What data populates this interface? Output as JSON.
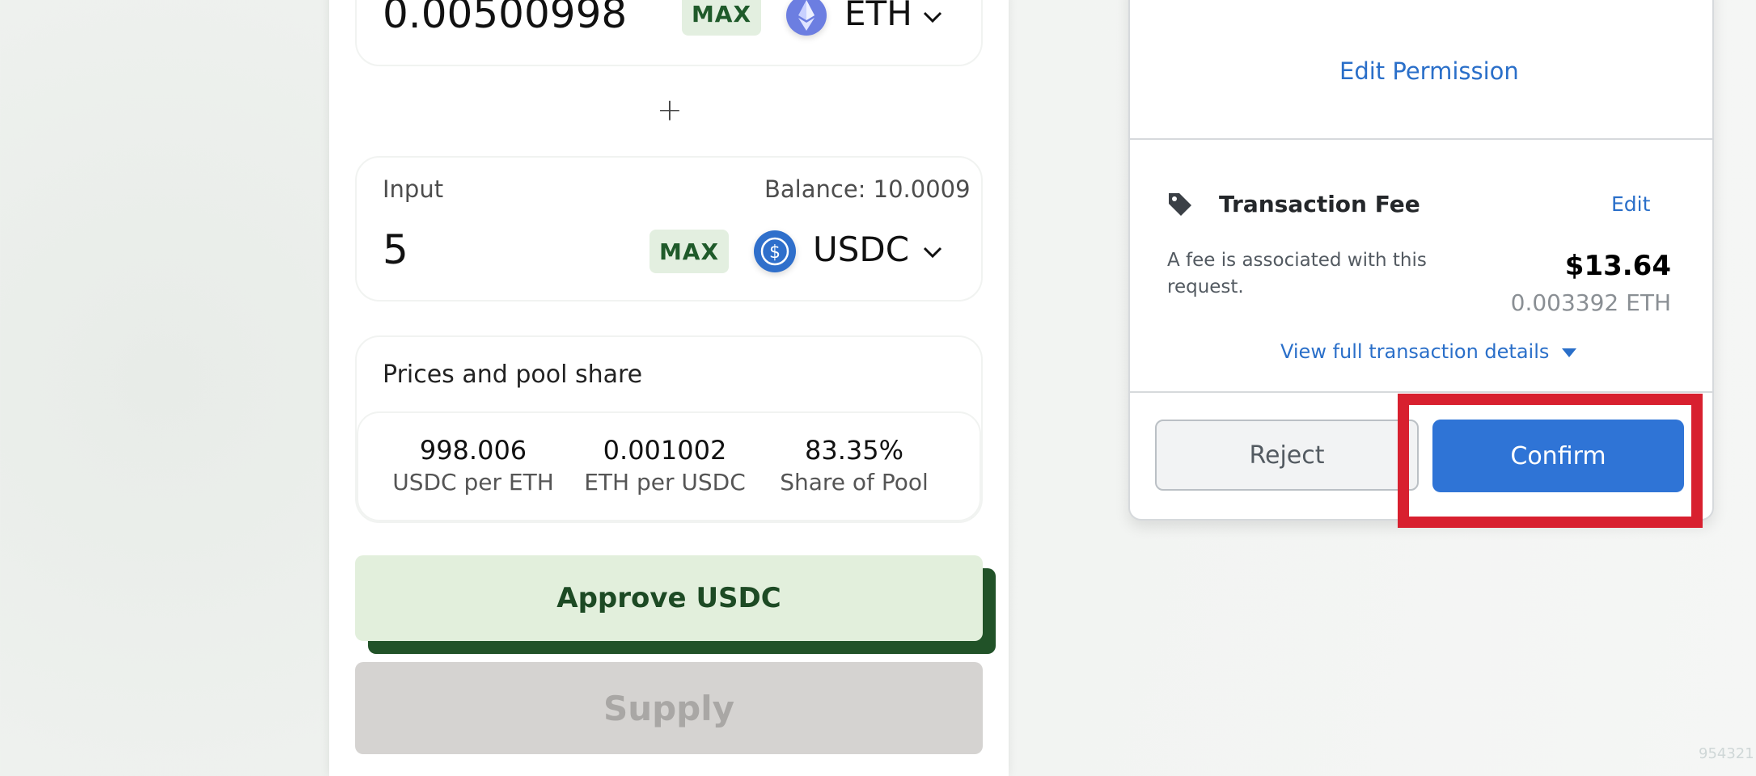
{
  "pool_form": {
    "top_input": {
      "amount": "0.00500998",
      "max_label": "MAX",
      "token": "ETH"
    },
    "plus_symbol": "+",
    "second_input": {
      "label": "Input",
      "balance": "Balance: 10.0009",
      "amount": "5",
      "max_label": "MAX",
      "token": "USDC"
    },
    "prices": {
      "title": "Prices and pool share",
      "items": [
        {
          "value": "998.006",
          "label": "USDC per ETH"
        },
        {
          "value": "0.001002",
          "label": "ETH per USDC"
        },
        {
          "value": "83.35%",
          "label": "Share of Pool"
        }
      ]
    },
    "approve_label": "Approve USDC",
    "supply_label": "Supply"
  },
  "wallet_popup": {
    "edit_permission": "Edit Permission",
    "fee_title": "Transaction Fee",
    "fee_edit": "Edit",
    "fee_desc_line1": "A fee is associated with this",
    "fee_desc_line2": "request.",
    "fee_usd": "$13.64",
    "fee_eth": "0.003392 ETH",
    "view_details": "View full transaction details",
    "reject_label": "Reject",
    "confirm_label": "Confirm"
  },
  "colors": {
    "confirm_blue": "#2f74d6",
    "highlight_red": "#d8202f",
    "approve_green": "#e2efdc"
  },
  "watermark": "954321"
}
